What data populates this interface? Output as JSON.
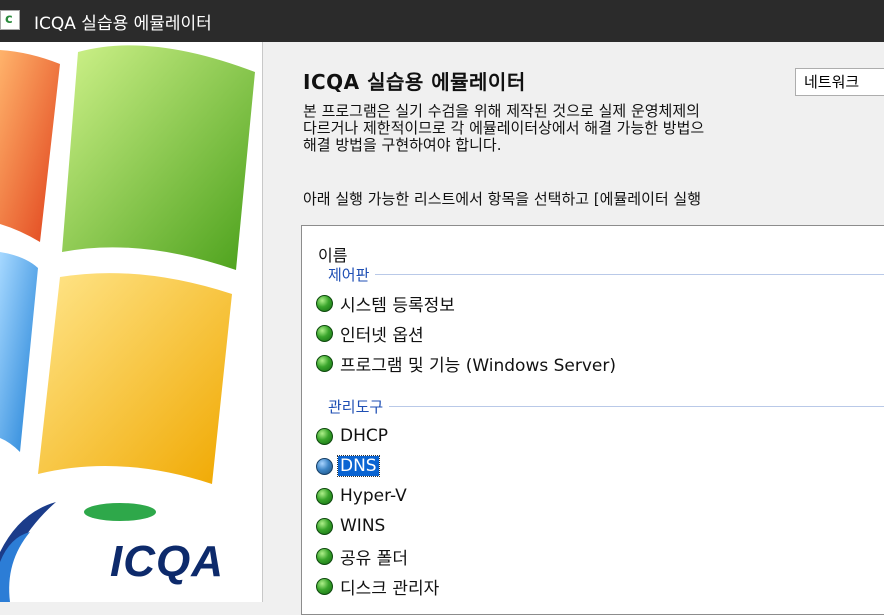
{
  "window": {
    "title": "ICQA 실습용 에뮬레이터",
    "icon_letter": "c"
  },
  "brand": {
    "logo_text": "ICQA"
  },
  "main": {
    "heading": "ICQA 실습용 에뮬레이터",
    "network_button": "네트워크",
    "description": [
      "본 프로그램은 실기 수검을 위해 제작된 것으로 실제 운영체제의",
      "다르거나 제한적이므로 각 에뮬레이터상에서 해결 가능한 방법으",
      "해결 방법을 구현하여야 합니다."
    ],
    "instruction": "아래 실행 가능한 리스트에서 항목을 선택하고 [에뮬레이터 실행"
  },
  "list": {
    "column_header": "이름",
    "groups": [
      {
        "label": "제어판",
        "items": [
          "시스템 등록정보",
          "인터넷 옵션",
          "프로그램 및 기능 (Windows Server)"
        ]
      },
      {
        "label": "관리도구",
        "items": [
          "DHCP",
          "DNS",
          "Hyper-V",
          "WINS",
          "공유 폴더",
          "디스크 관리자"
        ]
      }
    ],
    "selected_item": "DNS"
  },
  "colors": {
    "selection": "#0a64d2",
    "group_label": "#1f4fb4",
    "titlebar": "#2b2b2b"
  }
}
